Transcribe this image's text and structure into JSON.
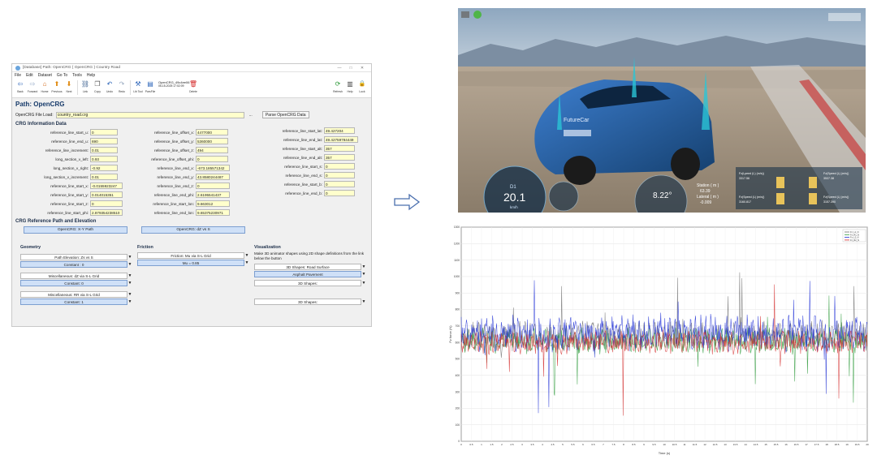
{
  "window": {
    "title": "[Database] Path: OpenCRG { OpenCRG } Country Road",
    "controls": [
      "—",
      "□",
      "✕"
    ]
  },
  "menu": [
    "File",
    "Edit",
    "Dataset",
    "Go To",
    "Tools",
    "Help"
  ],
  "toolbar": {
    "items": [
      {
        "label": "Back",
        "icon": "back-arrow-icon",
        "glyph": "⇦"
      },
      {
        "label": "Forward",
        "icon": "forward-arrow-icon",
        "glyph": "⇨"
      },
      {
        "label": "Home",
        "icon": "home-icon",
        "glyph": "⌂"
      },
      {
        "label": "Previous",
        "icon": "previous-icon",
        "glyph": "⬆"
      },
      {
        "label": "Next",
        "icon": "next-icon",
        "glyph": "⬇"
      },
      {
        "label": "Link",
        "icon": "link-icon",
        "glyph": "⛓"
      },
      {
        "label": "Copy",
        "icon": "copy-icon",
        "glyph": "❐"
      },
      {
        "label": "Undo",
        "icon": "undo-icon",
        "glyph": "↶"
      },
      {
        "label": "Redo",
        "icon": "redo-icon",
        "glyph": "↷"
      },
      {
        "label": "Lib Tool",
        "icon": "lib-tool-icon",
        "glyph": "⚒"
      },
      {
        "label": "ParsFile",
        "icon": "parsfile-icon",
        "glyph": "▤"
      }
    ],
    "dataset_name": "OpenCRG_49c4ee06",
    "dataset_date": "05-15-2025 17:02:09",
    "delete_label": "Delete",
    "right_items": [
      {
        "label": "Refresh",
        "icon": "refresh-icon",
        "glyph": "⟳"
      },
      {
        "label": "Help",
        "icon": "help-book-icon",
        "glyph": "▥"
      },
      {
        "label": "Lock",
        "icon": "lock-icon",
        "glyph": "🔒"
      }
    ]
  },
  "page_title": "Path: OpenCRG",
  "file_row": {
    "label": "OpenCRG File Load:",
    "value": "country_road.crg",
    "browse": "...",
    "parse_button": "Parse OpenCRG Data"
  },
  "crg_info_title": "CRG Information Data",
  "info_col1": [
    {
      "k": "reference_line_start_u:",
      "v": "0"
    },
    {
      "k": "reference_line_end_u:",
      "v": "690"
    },
    {
      "k": "reference_line_increment:",
      "v": "0.01"
    },
    {
      "k": "long_section_v_left:",
      "v": "0.93"
    },
    {
      "k": "long_section_v_right:",
      "v": "-0.92"
    },
    {
      "k": "long_section_v_increment:",
      "v": "0.01"
    },
    {
      "k": "reference_line_start_x:",
      "v": "-0.0155923247"
    },
    {
      "k": "reference_line_start_y:",
      "v": "0.014015351"
    },
    {
      "k": "reference_line_start_z:",
      "v": "0"
    },
    {
      "k": "reference_line_start_phi:",
      "v": "2.879354238510"
    }
  ],
  "info_col2": [
    {
      "k": "reference_line_offset_x:",
      "v": "4477000"
    },
    {
      "k": "reference_line_offset_y:",
      "v": "5360000"
    },
    {
      "k": "reference_line_offset_z:",
      "v": "494"
    },
    {
      "k": "reference_line_offset_phi:",
      "v": "0"
    },
    {
      "k": "reference_line_end_x:",
      "v": "-673.185571342"
    },
    {
      "k": "reference_line_end_y:",
      "v": "43.8580244487"
    },
    {
      "k": "reference_line_end_z:",
      "v": "0"
    },
    {
      "k": "reference_line_end_phi:",
      "v": "2.6195541437"
    },
    {
      "k": "reference_line_start_lon:",
      "v": "9.663012"
    },
    {
      "k": "reference_line_end_lon:",
      "v": "9.65375230971"
    }
  ],
  "info_col3": [
    {
      "k": "reference_line_start_lat:",
      "v": "49.427204"
    },
    {
      "k": "reference_line_end_lat:",
      "v": "49.42759784449"
    },
    {
      "k": "reference_line_start_alt:",
      "v": "357"
    },
    {
      "k": "reference_line_end_alt:",
      "v": "357"
    },
    {
      "k": "reference_line_start_s:",
      "v": "0"
    },
    {
      "k": "reference_line_end_s:",
      "v": "0"
    },
    {
      "k": "reference_line_start_b:",
      "v": "0"
    },
    {
      "k": "reference_line_end_b:",
      "v": "0"
    }
  ],
  "ref_path_title": "CRG Reference Path and Elevation",
  "ref_buttons": [
    "OpenCRG: X-Y Path",
    "OpenCRG: dZ vs S"
  ],
  "geometry": {
    "title": "Geometry",
    "items": [
      {
        "label": "Path Elevation: Zs vs S",
        "value": "Constant : 0"
      },
      {
        "label": "Miscellaneous: dZ via S-L Grid",
        "value": "Constant: 0"
      },
      {
        "label": "Miscellaneous: RR via S-L Grid",
        "value": "Constant: 1"
      }
    ]
  },
  "friction": {
    "title": "Friction",
    "label": "Friction: Mu via S-L Grid",
    "value": "Mu = 0.85"
  },
  "visualization": {
    "title": "Visualization",
    "note": "Make 3D animator shapes using 2D shape definitions from the link below the button",
    "shape_label": "3D Shapes: Road Surface",
    "shape_value": "Asphalt Pavement",
    "shapes1": "3D Shapes:",
    "shapes2": "3D Shapes:"
  },
  "sim_hud": {
    "gear": "D1",
    "speed": "20.1",
    "speed_unit": "km/h",
    "steer": "8.22°",
    "station_label": "Station ( m )",
    "station_value": "63.39",
    "lateral_label": "Lateral ( m )",
    "lateral_value": "-0.009",
    "car_brand": "FutureCar",
    "tires": [
      {
        "label": "Fz(Lpeed (L) (m/s))",
        "value": "3317.56"
      },
      {
        "label": "Fz(Speed (L) (m/s))",
        "value": "3537.38"
      },
      {
        "label": "Fz(Speed (L) (m/s))",
        "value": "3160.817"
      },
      {
        "label": "Fz(Speed (L) (m/s))",
        "value": "3157.390"
      }
    ]
  },
  "chart_data": {
    "type": "line",
    "title": "",
    "xlabel": "Time (s)",
    "ylabel": "Fz force (N)",
    "xlim": [
      0,
      20
    ],
    "ylim": [
      0,
      1300
    ],
    "legend_placement": "top-right",
    "grid": true,
    "series": [
      {
        "name": "Fz_L1_N",
        "color": "#6e6e6e",
        "mean": 640,
        "amp": 70,
        "seed": 3
      },
      {
        "name": "Fz_R1_N",
        "color": "#2d9a3a",
        "mean": 610,
        "amp": 60,
        "seed": 7
      },
      {
        "name": "Fz_L2_N",
        "color": "#1f2fd6",
        "mean": 655,
        "amp": 85,
        "seed": 11
      },
      {
        "name": "Fz_R2_N",
        "color": "#d42a2a",
        "mean": 600,
        "amp": 55,
        "seed": 17
      }
    ],
    "xticks": [
      0,
      0.5,
      1,
      1.5,
      2,
      2.5,
      3,
      3.5,
      4,
      4.5,
      5,
      5.5,
      6,
      6.5,
      7,
      7.5,
      8,
      8.5,
      9,
      9.5,
      10,
      10.5,
      11,
      11.5,
      12,
      12.5,
      13,
      13.5,
      14,
      14.5,
      15,
      15.5,
      16,
      16.5,
      17,
      17.5,
      18,
      18.5,
      19,
      19.5,
      20
    ],
    "yticks": [
      0,
      100,
      200,
      300,
      400,
      500,
      600,
      700,
      800,
      900,
      1000,
      1100,
      1200,
      1300
    ]
  }
}
